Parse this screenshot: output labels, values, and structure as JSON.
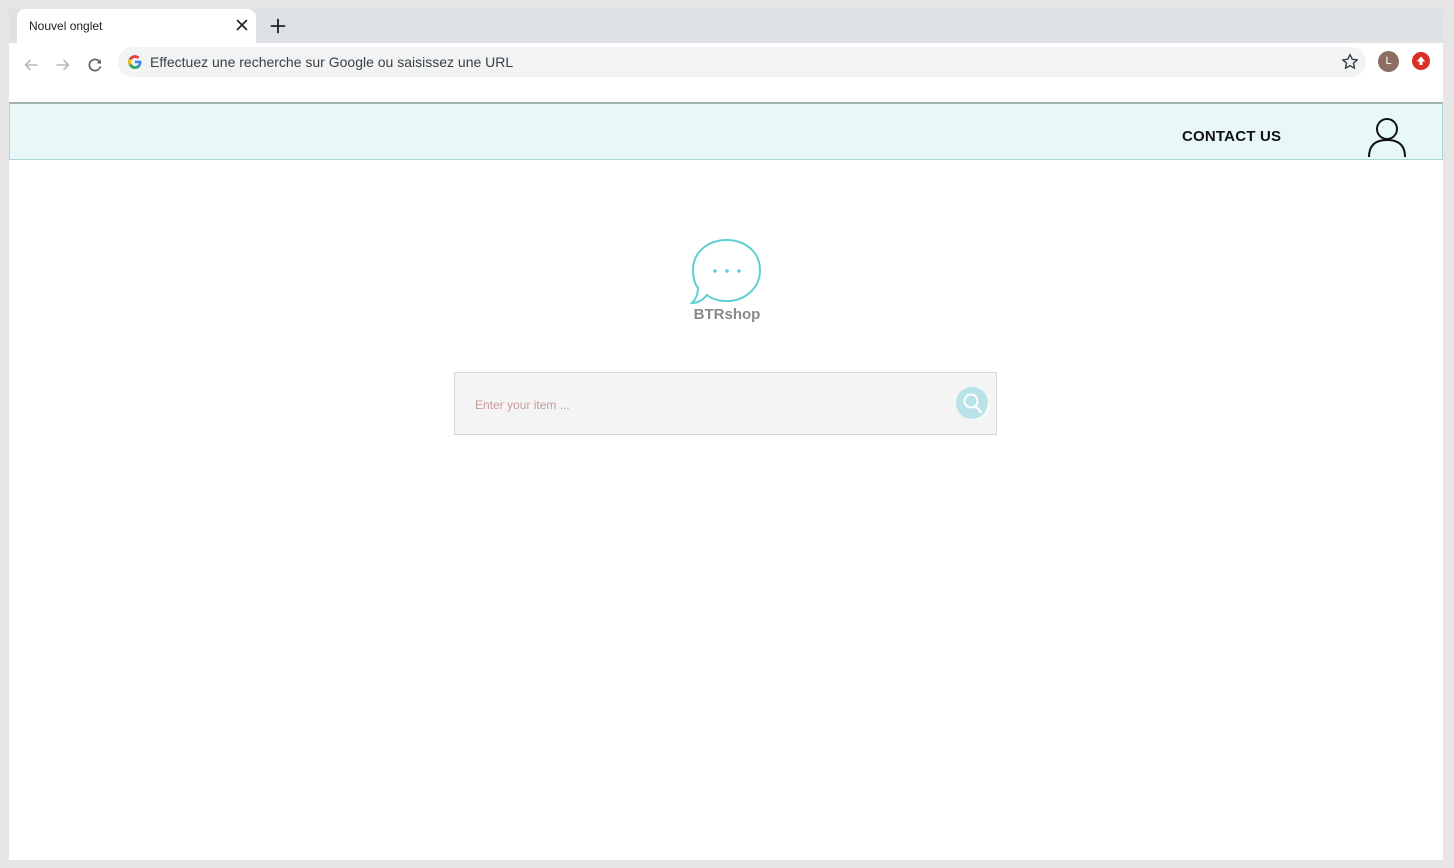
{
  "browser": {
    "tab_title": "Nouvel onglet",
    "omnibox_placeholder": "Effectuez une recherche sur Google ou saisissez une URL",
    "profile_initial": "L"
  },
  "header": {
    "contact_label": "CONTACT US"
  },
  "logo": {
    "name": "BTRshop"
  },
  "search": {
    "placeholder": "Enter your item ..."
  },
  "colors": {
    "accent": "#5ecfd3",
    "header_bg": "#e8f8f8",
    "search_button": "#b7e3e8"
  }
}
